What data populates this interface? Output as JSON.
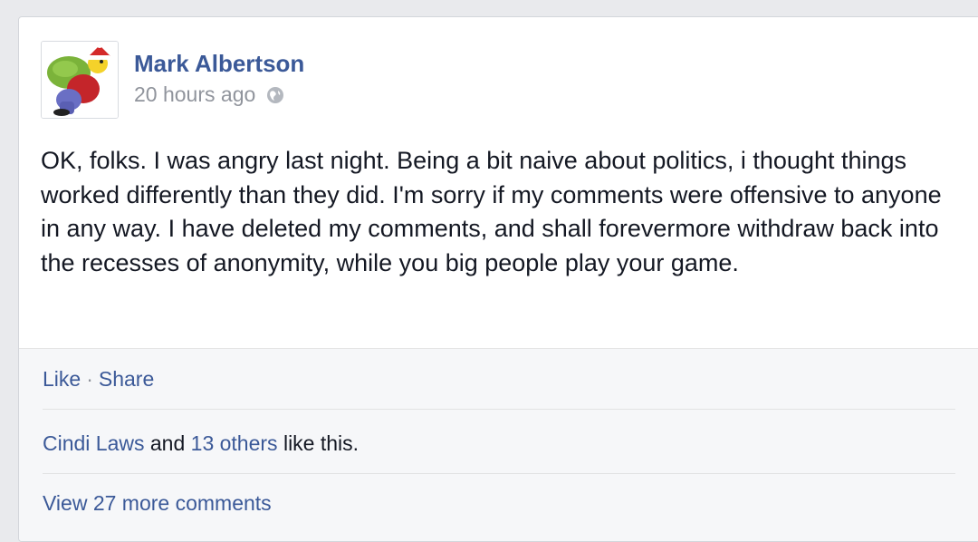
{
  "post": {
    "author": "Mark Albertson",
    "timestamp": "20 hours ago",
    "privacy_icon": "globe-icon",
    "avatar_icon": "christmas-character-avatar",
    "text": "OK, folks. I was angry last night. Being a bit naive about politics, i thought things worked differently than they did. I'm sorry if my comments were offensive to anyone in any way. I have deleted my comments, and shall forevermore withdraw back into the recesses of anonymity, while you big people play your game."
  },
  "actions": {
    "like_label": "Like",
    "separator": "·",
    "share_label": "Share"
  },
  "likes": {
    "first_name": "Cindi Laws",
    "and_text": " and ",
    "others_text": "13 others",
    "suffix": " like this."
  },
  "comments": {
    "view_more_label": "View 27 more comments"
  },
  "colors": {
    "link": "#3b5998",
    "text": "#141823",
    "meta": "#90949c",
    "background": "#e9eaed",
    "footer_bg": "#f6f7f9"
  }
}
